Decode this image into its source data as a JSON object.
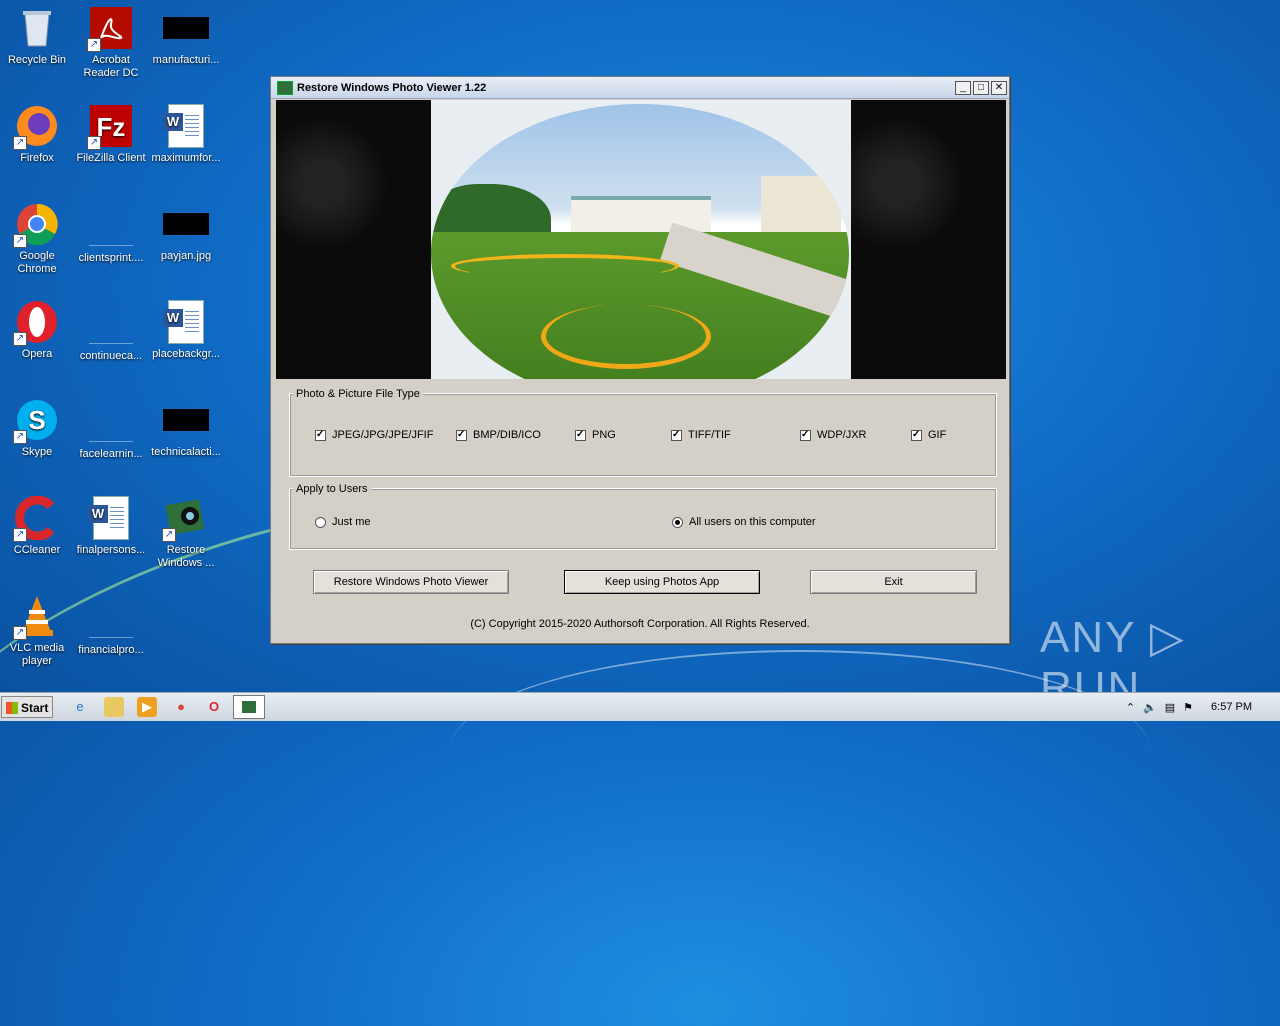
{
  "desktop": {
    "icons": [
      {
        "label": "Recycle Bin"
      },
      {
        "label": "Acrobat Reader DC"
      },
      {
        "label": "manufacturi..."
      },
      {
        "label": "Firefox"
      },
      {
        "label": "FileZilla Client"
      },
      {
        "label": "maximumfor..."
      },
      {
        "label": "Google Chrome"
      },
      {
        "label": "clientsprint...."
      },
      {
        "label": "payjan.jpg"
      },
      {
        "label": "Opera"
      },
      {
        "label": "continueca..."
      },
      {
        "label": "placebackgr..."
      },
      {
        "label": "Skype"
      },
      {
        "label": "facelearnin..."
      },
      {
        "label": "technicalacti..."
      },
      {
        "label": "CCleaner"
      },
      {
        "label": "finalpersons..."
      },
      {
        "label": "Restore Windows ..."
      },
      {
        "label": "VLC media player"
      },
      {
        "label": "financialpro..."
      }
    ]
  },
  "window": {
    "title": "Restore Windows Photo Viewer 1.22",
    "controls": {
      "minimize": "_",
      "maximize": "□",
      "close": "✕"
    },
    "filetype_group": {
      "legend": "Photo & Picture File Type",
      "options": [
        {
          "label": "JPEG/JPG/JPE/JFIF",
          "checked": true
        },
        {
          "label": "BMP/DIB/ICO",
          "checked": true
        },
        {
          "label": "PNG",
          "checked": true
        },
        {
          "label": "TIFF/TIF",
          "checked": true
        },
        {
          "label": "WDP/JXR",
          "checked": true
        },
        {
          "label": "GIF",
          "checked": true
        }
      ]
    },
    "users_group": {
      "legend": "Apply to Users",
      "options": [
        {
          "label": "Just me",
          "selected": false
        },
        {
          "label": "All users on this computer",
          "selected": true
        }
      ]
    },
    "buttons": {
      "restore": "Restore Windows Photo Viewer",
      "keep": "Keep using Photos App",
      "exit": "Exit"
    },
    "copyright": "(C) Copyright 2015-2020 Authorsoft Corporation. All Rights Reserved."
  },
  "taskbar": {
    "start": "Start",
    "clock": "6:57 PM"
  },
  "watermark": "ANY ▷ RUN"
}
